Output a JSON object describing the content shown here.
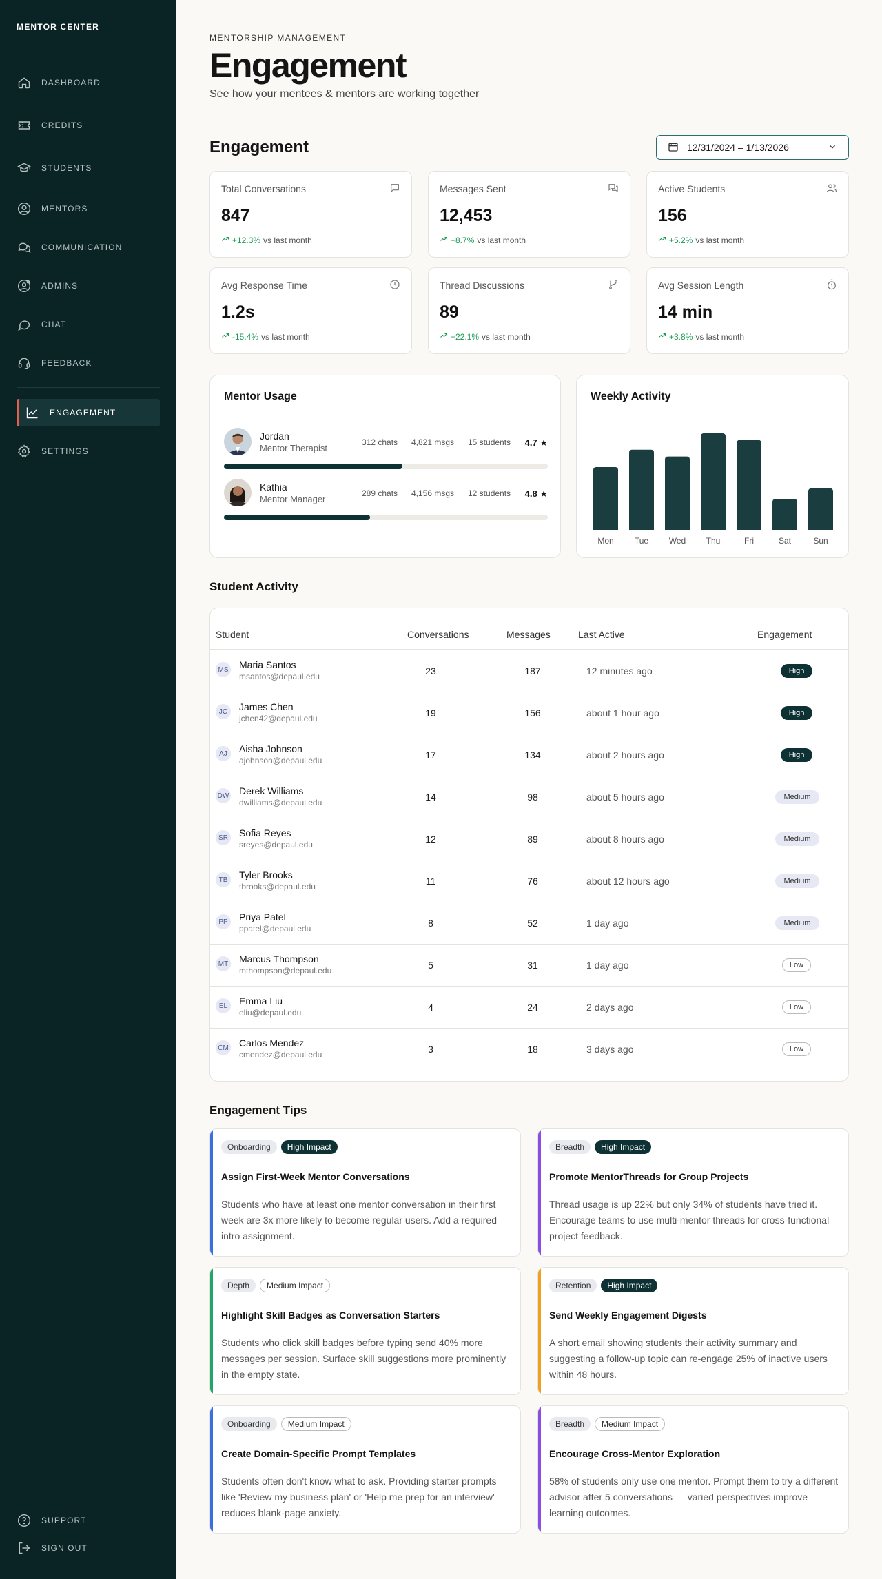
{
  "sidebar": {
    "brand": "MENTOR CENTER",
    "items": [
      {
        "label": "DASHBOARD",
        "icon": "home-icon"
      },
      {
        "label": "CREDITS",
        "icon": "ticket-icon"
      },
      {
        "label": "STUDENTS",
        "icon": "graduation-cap-icon"
      },
      {
        "label": "MENTORS",
        "icon": "user-circle-icon"
      },
      {
        "label": "COMMUNICATION",
        "icon": "chat-bubbles-icon"
      },
      {
        "label": "ADMINS",
        "icon": "admin-gear-user-icon"
      },
      {
        "label": "CHAT",
        "icon": "chat-bubble-icon"
      },
      {
        "label": "FEEDBACK",
        "icon": "headset-icon"
      },
      {
        "label": "ENGAGEMENT",
        "icon": "trend-chart-icon"
      },
      {
        "label": "SETTINGS",
        "icon": "gear-icon"
      }
    ],
    "support": "SUPPORT",
    "signout": "SIGN OUT",
    "colors": {
      "bg": "#0a2324",
      "active_bg": "#163638",
      "active_accent": "#e2604d"
    }
  },
  "header": {
    "kicker": "MENTORSHIP MANAGEMENT",
    "title": "Engagement",
    "subtitle": "See how your mentees & mentors are working together"
  },
  "engagement": {
    "section_title": "Engagement",
    "date_range": "12/31/2024 – 1/13/2026",
    "stats": [
      {
        "label": "Total Conversations",
        "value": "847",
        "change": "+12.3%",
        "suffix": "vs last month",
        "icon": "message-square-icon"
      },
      {
        "label": "Messages Sent",
        "value": "12,453",
        "change": "+8.7%",
        "suffix": "vs last month",
        "icon": "messages-icon"
      },
      {
        "label": "Active Students",
        "value": "156",
        "change": "+5.2%",
        "suffix": "vs last month",
        "icon": "users-icon"
      },
      {
        "label": "Avg Response Time",
        "value": "1.2s",
        "change": "-15.4%",
        "suffix": "vs last month",
        "icon": "clock-icon"
      },
      {
        "label": "Thread Discussions",
        "value": "89",
        "change": "+22.1%",
        "suffix": "vs last month",
        "icon": "git-branch-icon"
      },
      {
        "label": "Avg Session Length",
        "value": "14 min",
        "change": "+3.8%",
        "suffix": "vs last month",
        "icon": "timer-icon"
      }
    ],
    "trend_color": "#1d9a57"
  },
  "mentor_usage": {
    "title": "Mentor Usage",
    "mentors": [
      {
        "name": "Jordan",
        "role": "Mentor Therapist",
        "chats": "312 chats",
        "msgs": "4,821 msgs",
        "students": "15 students",
        "rating": "4.7 ★",
        "usage": 0.55
      },
      {
        "name": "Kathia",
        "role": "Mentor Manager",
        "chats": "289 chats",
        "msgs": "4,156 msgs",
        "students": "12 students",
        "rating": "4.8 ★",
        "usage": 0.45
      }
    ]
  },
  "chart_data": {
    "type": "bar",
    "title": "Weekly Activity",
    "categories": [
      "Mon",
      "Tue",
      "Wed",
      "Thu",
      "Fri",
      "Sat",
      "Sun"
    ],
    "values": [
      65,
      83,
      76,
      100,
      93,
      32,
      43
    ],
    "ylim": [
      0,
      100
    ],
    "grid": false,
    "bar_color": "#1a3d3f"
  },
  "student_activity": {
    "title": "Student Activity",
    "columns": [
      "Student",
      "Conversations",
      "Messages",
      "Last Active",
      "Engagement"
    ],
    "rows": [
      {
        "initials": "MS",
        "name": "Maria Santos",
        "email": "msantos@depaul.edu",
        "conversations": "23",
        "messages": "187",
        "last_active": "12 minutes ago",
        "engagement": "High"
      },
      {
        "initials": "JC",
        "name": "James Chen",
        "email": "jchen42@depaul.edu",
        "conversations": "19",
        "messages": "156",
        "last_active": "about 1 hour ago",
        "engagement": "High"
      },
      {
        "initials": "AJ",
        "name": "Aisha Johnson",
        "email": "ajohnson@depaul.edu",
        "conversations": "17",
        "messages": "134",
        "last_active": "about 2 hours ago",
        "engagement": "High"
      },
      {
        "initials": "DW",
        "name": "Derek Williams",
        "email": "dwilliams@depaul.edu",
        "conversations": "14",
        "messages": "98",
        "last_active": "about 5 hours ago",
        "engagement": "Medium"
      },
      {
        "initials": "SR",
        "name": "Sofia Reyes",
        "email": "sreyes@depaul.edu",
        "conversations": "12",
        "messages": "89",
        "last_active": "about 8 hours ago",
        "engagement": "Medium"
      },
      {
        "initials": "TB",
        "name": "Tyler Brooks",
        "email": "tbrooks@depaul.edu",
        "conversations": "11",
        "messages": "76",
        "last_active": "about 12 hours ago",
        "engagement": "Medium"
      },
      {
        "initials": "PP",
        "name": "Priya Patel",
        "email": "ppatel@depaul.edu",
        "conversations": "8",
        "messages": "52",
        "last_active": "1 day ago",
        "engagement": "Medium"
      },
      {
        "initials": "MT",
        "name": "Marcus Thompson",
        "email": "mthompson@depaul.edu",
        "conversations": "5",
        "messages": "31",
        "last_active": "1 day ago",
        "engagement": "Low"
      },
      {
        "initials": "EL",
        "name": "Emma Liu",
        "email": "eliu@depaul.edu",
        "conversations": "4",
        "messages": "24",
        "last_active": "2 days ago",
        "engagement": "Low"
      },
      {
        "initials": "CM",
        "name": "Carlos Mendez",
        "email": "cmendez@depaul.edu",
        "conversations": "3",
        "messages": "18",
        "last_active": "3 days ago",
        "engagement": "Low"
      }
    ]
  },
  "tips": {
    "title": "Engagement Tips",
    "items": [
      {
        "category": "Onboarding",
        "impact": "High Impact",
        "level": "hi",
        "accent": "#3b6fe0",
        "title": "Assign First-Week Mentor Conversations",
        "body": "Students who have at least one mentor conversation in their first week are 3x more likely to become regular users. Add a required intro assignment."
      },
      {
        "category": "Breadth",
        "impact": "High Impact",
        "level": "hi",
        "accent": "#8a4de8",
        "title": "Promote MentorThreads for Group Projects",
        "body": "Thread usage is up 22% but only 34% of students have tried it. Encourage teams to use multi-mentor threads for cross-functional project feedback."
      },
      {
        "category": "Depth",
        "impact": "Medium Impact",
        "level": "med",
        "accent": "#22a566",
        "title": "Highlight Skill Badges as Conversation Starters",
        "body": "Students who click skill badges before typing send 40% more messages per session. Surface skill suggestions more prominently in the empty state."
      },
      {
        "category": "Retention",
        "impact": "High Impact",
        "level": "hi",
        "accent": "#f0a01e",
        "title": "Send Weekly Engagement Digests",
        "body": "A short email showing students their activity summary and suggesting a follow-up topic can re-engage 25% of inactive users within 48 hours."
      },
      {
        "category": "Onboarding",
        "impact": "Medium Impact",
        "level": "med",
        "accent": "#3b6fe0",
        "title": "Create Domain-Specific Prompt Templates",
        "body": "Students often don't know what to ask. Providing starter prompts like 'Review my business plan' or 'Help me prep for an interview' reduces blank-page anxiety."
      },
      {
        "category": "Breadth",
        "impact": "Medium Impact",
        "level": "med",
        "accent": "#8a4de8",
        "title": "Encourage Cross-Mentor Exploration",
        "body": "58% of students only use one mentor. Prompt them to try a different advisor after 5 conversations — varied perspectives improve learning outcomes."
      }
    ]
  }
}
